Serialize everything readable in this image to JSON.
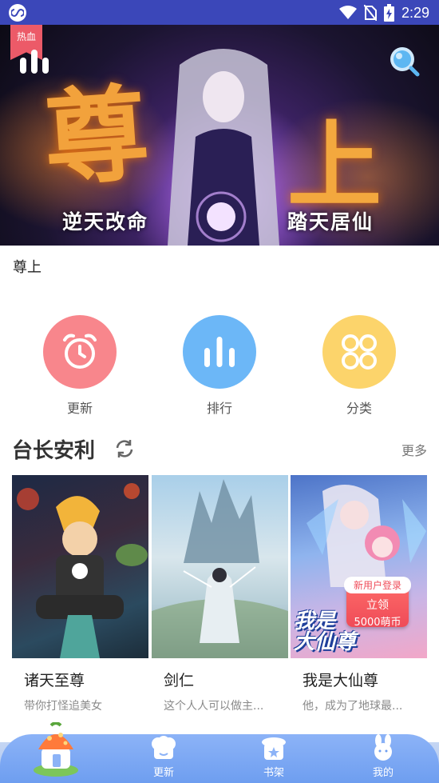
{
  "status_bar": {
    "time": "2:29"
  },
  "banner": {
    "badge": "热血",
    "big_left": "尊",
    "big_right": "上",
    "tagline_left": "逆天改命",
    "tagline_right": "踏天居仙",
    "title": "尊上"
  },
  "quick_entries": [
    {
      "label": "更新",
      "icon": "alarm-clock-icon",
      "color": "#f8868c"
    },
    {
      "label": "排行",
      "icon": "bar-chart-icon",
      "color": "#6cb7f7"
    },
    {
      "label": "分类",
      "icon": "grid-circles-icon",
      "color": "#fcd46b"
    }
  ],
  "section": {
    "title": "台长安利",
    "more": "更多"
  },
  "comics": [
    {
      "name": "诸天至尊",
      "desc": "带你打怪追美女"
    },
    {
      "name": "剑仁",
      "desc": "这个人人可以做主..."
    },
    {
      "name": "我是大仙尊",
      "desc": "他，成为了地球最..."
    }
  ],
  "promo": {
    "top": "新用户登录",
    "line1": "立领",
    "line2": "5000萌币"
  },
  "cover_logo": {
    "line1": "我是",
    "line2": "大仙尊"
  },
  "bottom_nav": {
    "update": "更新",
    "shelf": "书架",
    "mine": "我的"
  },
  "colors": {
    "status_bar": "#3b47b9",
    "nav": "#7aa6f3",
    "hot_badge": "#ec5a68"
  }
}
